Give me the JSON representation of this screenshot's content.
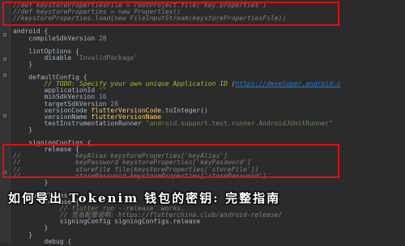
{
  "editor": {
    "lines": [
      {
        "tokens": [
          {
            "t": "//def keystorePropertiesFile = rootProject.file('key.properties')",
            "c": "cm"
          }
        ]
      },
      {
        "tokens": [
          {
            "t": "//def keystoreProperties = new Properties()",
            "c": "cm"
          }
        ]
      },
      {
        "tokens": [
          {
            "t": "//keystoreProperties.load(new FileInputStream(keystorePropertiesFile))",
            "c": "cm"
          }
        ]
      },
      {
        "tokens": [
          {
            "t": "",
            "c": ""
          }
        ]
      },
      {
        "tokens": [
          {
            "t": "android {",
            "c": ""
          }
        ]
      },
      {
        "tokens": [
          {
            "t": "    compileSdkVersion ",
            "c": ""
          },
          {
            "t": "28",
            "c": "num"
          }
        ]
      },
      {
        "tokens": [
          {
            "t": "",
            "c": ""
          }
        ]
      },
      {
        "tokens": [
          {
            "t": "    lintOptions {",
            "c": ""
          }
        ]
      },
      {
        "tokens": [
          {
            "t": "        disable ",
            "c": ""
          },
          {
            "t": "'InvalidPackage'",
            "c": "str"
          }
        ]
      },
      {
        "tokens": [
          {
            "t": "    }",
            "c": ""
          }
        ]
      },
      {
        "tokens": [
          {
            "t": "",
            "c": ""
          }
        ]
      },
      {
        "tokens": [
          {
            "t": "    defaultConfig {",
            "c": ""
          }
        ]
      },
      {
        "tokens": [
          {
            "t": "        // TODO: Specify your own unique Application ID (",
            "c": "todo"
          },
          {
            "t": "https://developer.android.c",
            "c": "link"
          }
        ]
      },
      {
        "tokens": [
          {
            "t": "        applicationId ",
            "c": ""
          },
          {
            "t": "\"\"",
            "c": "str"
          }
        ]
      },
      {
        "tokens": [
          {
            "t": "        minSdkVersion ",
            "c": ""
          },
          {
            "t": "16",
            "c": "num"
          }
        ]
      },
      {
        "tokens": [
          {
            "t": "        targetSdkVersion ",
            "c": ""
          },
          {
            "t": "28",
            "c": "num"
          }
        ]
      },
      {
        "tokens": [
          {
            "t": "        versionCode ",
            "c": ""
          },
          {
            "t": "flutterVersionCode",
            "c": "fn"
          },
          {
            "t": ".toInteger()",
            "c": ""
          }
        ]
      },
      {
        "tokens": [
          {
            "t": "        versionName ",
            "c": ""
          },
          {
            "t": "flutterVersionName",
            "c": "fn"
          }
        ]
      },
      {
        "tokens": [
          {
            "t": "        testInstrumentationRunner ",
            "c": ""
          },
          {
            "t": "\"android.support.test.runner.AndroidJUnitRunner\"",
            "c": "str"
          }
        ]
      },
      {
        "tokens": [
          {
            "t": "    }",
            "c": ""
          }
        ]
      },
      {
        "tokens": [
          {
            "t": "",
            "c": ""
          }
        ]
      },
      {
        "tokens": [
          {
            "t": "    signingConfigs {",
            "c": ""
          }
        ]
      },
      {
        "tokens": [
          {
            "t": "        release {",
            "c": ""
          }
        ]
      },
      {
        "tokens": [
          {
            "t": "//              keyAlias keystoreProperties['keyAlias']",
            "c": "cm"
          }
        ]
      },
      {
        "tokens": [
          {
            "t": "//              keyPassword keystoreProperties['keyPassword']",
            "c": "cm"
          }
        ]
      },
      {
        "tokens": [
          {
            "t": "//              storeFile file(keystoreProperties['storeFile'])",
            "c": "cm"
          }
        ]
      },
      {
        "tokens": [
          {
            "t": "//              storePassword keystoreProperties['storePassword']",
            "c": "cm"
          }
        ]
      },
      {
        "tokens": [
          {
            "t": "        }",
            "c": ""
          }
        ]
      },
      {
        "tokens": [
          {
            "t": "",
            "c": ""
          }
        ]
      },
      {
        "tokens": [
          {
            "t": "    buildTypes {",
            "c": ""
          }
        ]
      },
      {
        "tokens": [
          {
            "t": "        release {",
            "c": ""
          }
        ]
      },
      {
        "tokens": [
          {
            "t": "            // flutter run --release` works.",
            "c": "cm"
          }
        ]
      },
      {
        "tokens": [
          {
            "t": "            // 签名配置说明: https://flutterchina.club/android-release/",
            "c": "cm"
          }
        ]
      },
      {
        "tokens": [
          {
            "t": "            signingConfig signingConfigs.release",
            "c": ""
          }
        ]
      },
      {
        "tokens": [
          {
            "t": "        }",
            "c": ""
          }
        ]
      },
      {
        "tokens": [
          {
            "t": "    }",
            "c": ""
          }
        ]
      },
      {
        "tokens": [
          {
            "t": "        debug {",
            "c": ""
          }
        ]
      }
    ]
  },
  "overlay": {
    "title": "如何导出 Tokenim 钱包的密钥: 完整指南"
  },
  "colors": {
    "background": "#2b2b2b",
    "highlight_box": "#e01010"
  }
}
